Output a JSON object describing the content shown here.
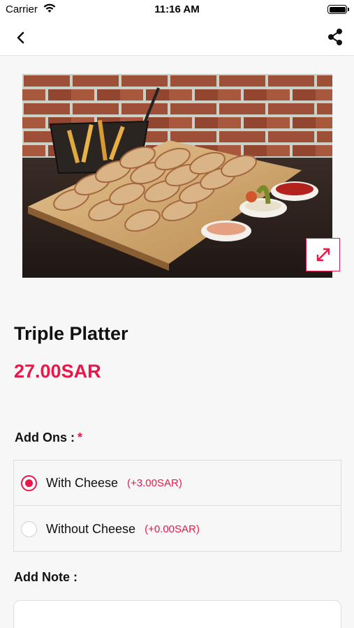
{
  "status_bar": {
    "carrier": "Carrier",
    "time": "11:16 AM"
  },
  "nav": {
    "back_icon": "chevron-left-icon",
    "share_icon": "share-icon"
  },
  "product": {
    "image_icon": "expand-icon",
    "title": "Triple Platter",
    "price": "27.00SAR"
  },
  "addons": {
    "label": "Add Ons :",
    "required_mark": "*",
    "options": [
      {
        "name": "With Cheese",
        "price": "(+3.00SAR)",
        "selected": true
      },
      {
        "name": "Without Cheese",
        "price": "(+0.00SAR)",
        "selected": false
      }
    ]
  },
  "note": {
    "label": "Add Note :",
    "value": "",
    "placeholder": ""
  },
  "colors": {
    "accent": "#e8194a",
    "background": "#f7f7f7"
  }
}
